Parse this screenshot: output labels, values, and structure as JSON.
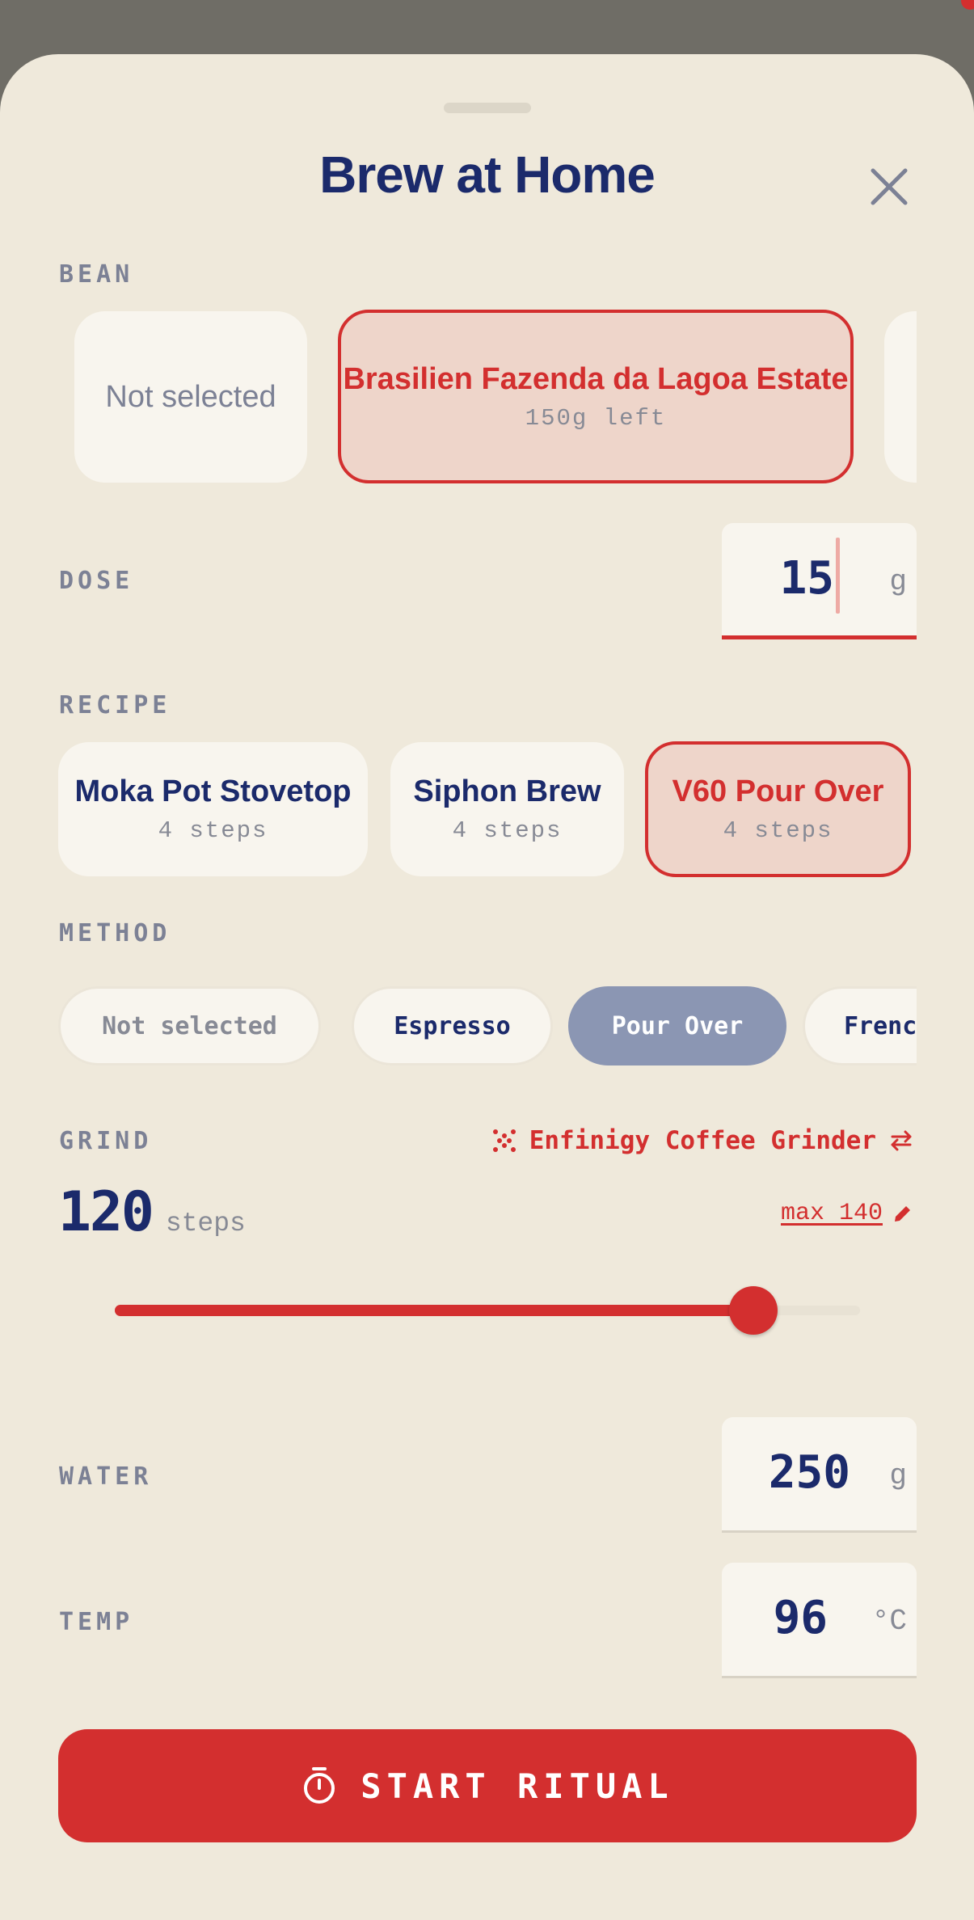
{
  "sheet": {
    "title": "Brew at Home",
    "close_icon": "close-icon"
  },
  "bean": {
    "label": "BEAN",
    "options": [
      {
        "name": "Not selected",
        "selected": false
      },
      {
        "name": "Brasilien Fazenda da Lagoa Estate",
        "remaining": "150g left",
        "selected": true
      }
    ]
  },
  "dose": {
    "label": "DOSE",
    "value": "15",
    "unit": "g"
  },
  "recipe": {
    "label": "RECIPE",
    "options": [
      {
        "name": "Moka Pot Stovetop",
        "steps": "4 steps",
        "selected": false
      },
      {
        "name": "Siphon Brew",
        "steps": "4 steps",
        "selected": false
      },
      {
        "name": "V60 Pour Over",
        "steps": "4 steps",
        "selected": true
      }
    ]
  },
  "method": {
    "label": "METHOD",
    "options": [
      "Not selected",
      "Espresso",
      "Pour Over",
      "French Press"
    ],
    "selected": "Pour Over"
  },
  "grind": {
    "label": "GRIND",
    "grinder": "Enfinigy Coffee Grinder",
    "grinder_icon": "grinder-icon",
    "swap_icon": "swap-icon",
    "value": "120",
    "unit": "steps",
    "max_label": "max 140",
    "edit_icon": "pencil-icon",
    "slider_fraction": 0.857
  },
  "water": {
    "label": "WATER",
    "value": "250",
    "unit": "g"
  },
  "temp": {
    "label": "TEMP",
    "value": "96",
    "unit": "°C"
  },
  "start": {
    "label": "START RITUAL",
    "icon": "timer-icon"
  },
  "colors": {
    "accent": "#d32f2f",
    "navy": "#1b2a6b",
    "muted": "#878a95",
    "background": "#efe9db",
    "card": "#f8f5ee",
    "selected_pill": "#8b96b3"
  }
}
